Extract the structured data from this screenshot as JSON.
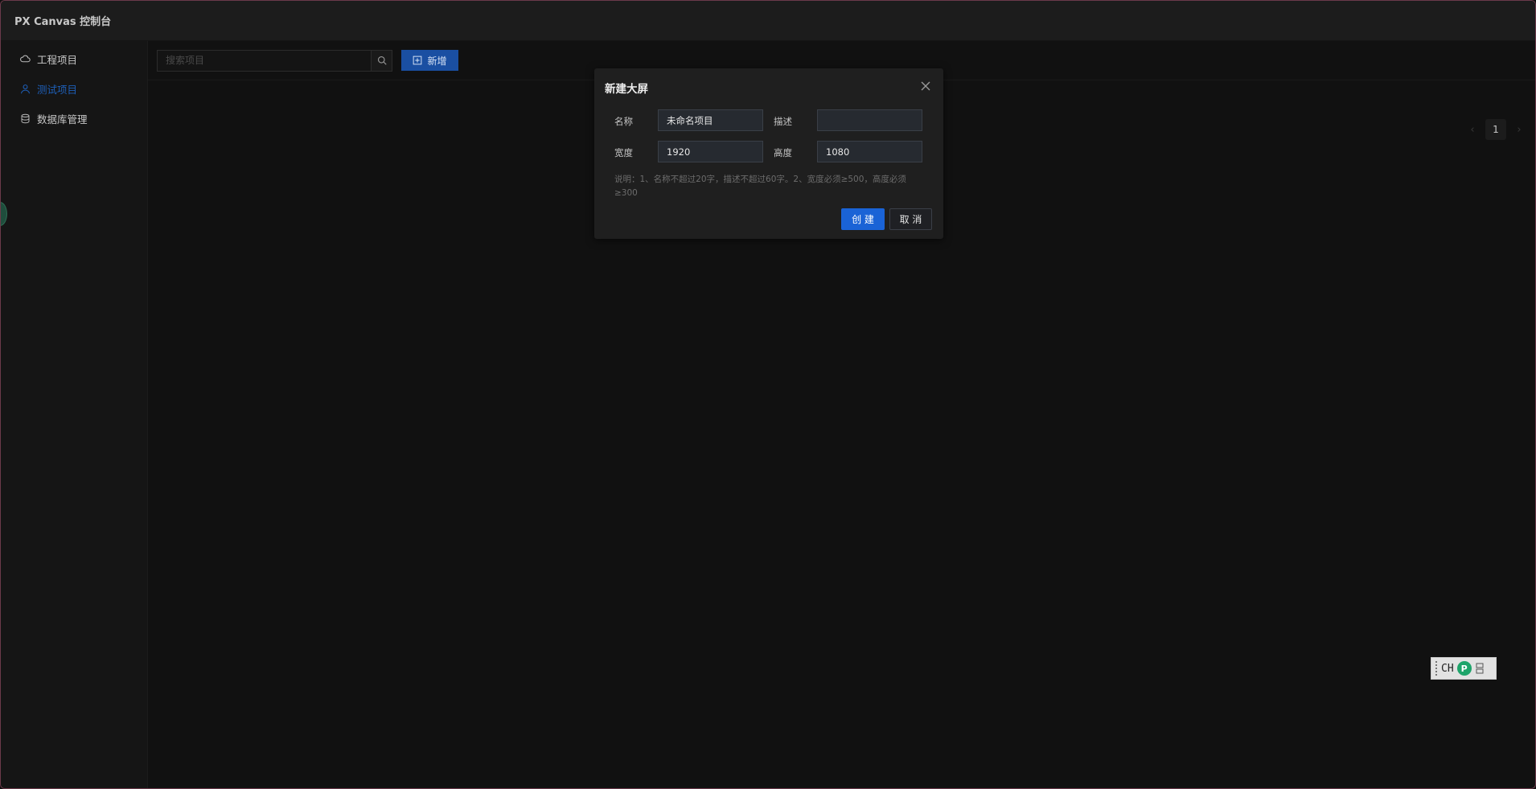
{
  "app": {
    "title": "PX Canvas 控制台"
  },
  "sidebar": {
    "items": [
      {
        "label": "工程项目",
        "icon": "cloud-icon",
        "active": false
      },
      {
        "label": "测试项目",
        "icon": "user-icon",
        "active": true
      },
      {
        "label": "数据库管理",
        "icon": "database-icon",
        "active": false
      }
    ]
  },
  "toolbar": {
    "search_placeholder": "搜索项目",
    "add_label": "新增"
  },
  "pagination": {
    "current": "1",
    "prev": "‹",
    "next": "›"
  },
  "dialog": {
    "title": "新建大屏",
    "fields": {
      "name": {
        "label": "名称",
        "value": "未命名项目"
      },
      "desc": {
        "label": "描述",
        "value": ""
      },
      "width": {
        "label": "宽度",
        "value": "1920"
      },
      "height": {
        "label": "高度",
        "value": "1080"
      }
    },
    "note": "说明：1、名称不超过20字，描述不超过60字。2、宽度必须≥500，高度必须≥300",
    "create_label": "创 建",
    "cancel_label": "取 消"
  },
  "ime": {
    "text": "CH"
  },
  "colors": {
    "accent": "#1a63d6",
    "active_nav": "#1e5fb8",
    "background": "#111111"
  }
}
